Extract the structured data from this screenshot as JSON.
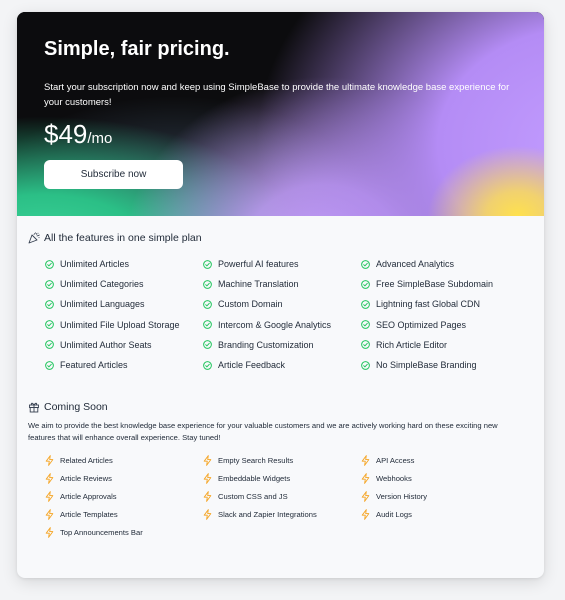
{
  "hero": {
    "title": "Simple, fair pricing.",
    "description": "Start your subscription now and keep using SimpleBase to provide the ultimate knowledge base experience for your customers!",
    "price": "$49",
    "period": "/mo",
    "subscribe_label": "Subscribe now"
  },
  "features": {
    "title": "All the features in one simple plan",
    "icon": "party-popper-icon",
    "columns": [
      [
        "Unlimited Articles",
        "Unlimited Categories",
        "Unlimited Languages",
        "Unlimited File Upload Storage",
        "Unlimited Author Seats",
        "Featured Articles"
      ],
      [
        "Powerful AI features",
        "Machine Translation",
        "Custom Domain",
        "Intercom & Google Analytics",
        "Branding Customization",
        "Article Feedback"
      ],
      [
        "Advanced Analytics",
        "Free SimpleBase Subdomain",
        "Lightning fast Global CDN",
        "SEO Optimized Pages",
        "Rich Article Editor",
        "No SimpleBase Branding"
      ]
    ]
  },
  "coming_soon": {
    "title": "Coming Soon",
    "icon": "gift-icon",
    "description": "We aim to provide the best knowledge base experience for your valuable customers and we are actively working hard on these exciting new features that will enhance overall experience. Stay tuned!",
    "columns": [
      [
        "Related Articles",
        "Article Reviews",
        "Article Approvals",
        "Article Templates",
        "Top Announcements Bar"
      ],
      [
        "Empty Search Results",
        "Embeddable Widgets",
        "Custom CSS and JS",
        "Slack and Zapier Integrations"
      ],
      [
        "API Access",
        "Webhooks",
        "Version History",
        "Audit Logs"
      ]
    ]
  },
  "colors": {
    "check": "#22c55e",
    "bolt": "#f5a524",
    "hero_dark": "#0c0c0e",
    "hero_purple": "#b48cf5",
    "hero_green": "#2bbf86",
    "hero_yellow": "#ffe14d"
  }
}
